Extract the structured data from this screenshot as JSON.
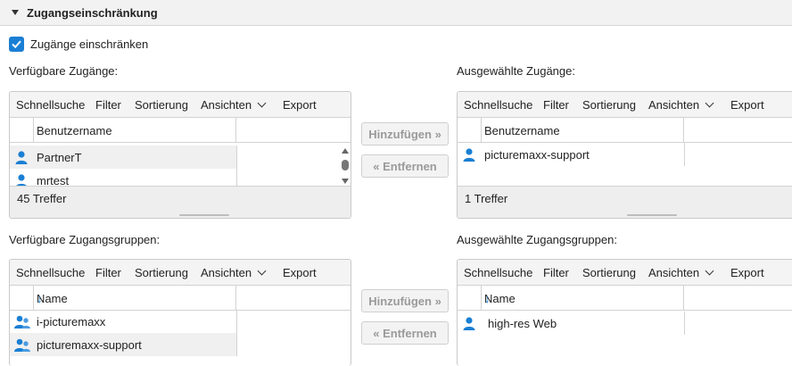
{
  "section": {
    "title": "Zugangseinschränkung"
  },
  "restrict": {
    "label": "Zugänge einschränken",
    "checked": true
  },
  "toolbar": {
    "quick": "Schnellsuche",
    "filter": "Filter",
    "sort": "Sortierung",
    "views": "Ansichten",
    "export": "Export"
  },
  "buttons": {
    "add": "Hinzufügen »",
    "remove": "« Entfernen"
  },
  "avail_users": {
    "label": "Verfügbare Zugänge:",
    "column": "Benutzername",
    "rows": [
      "PartnerT",
      "mrtest"
    ],
    "count": "45 Treffer"
  },
  "sel_users": {
    "label": "Ausgewählte Zugänge:",
    "column": "Benutzername",
    "rows": [
      "picturemaxx-support"
    ],
    "count": "1 Treffer"
  },
  "avail_groups": {
    "label": "Verfügbare Zugangsgruppen:",
    "column": "Name",
    "sort_icon": "↓",
    "rows": [
      "i-picturemaxx",
      "picturemaxx-support"
    ]
  },
  "sel_groups": {
    "label": "Ausgewählte Zugangsgruppen:",
    "column": "Name",
    "sort_icon": "↓",
    "rows": [
      "high-res Web"
    ]
  },
  "colors": {
    "accent": "#1a7fd4"
  }
}
